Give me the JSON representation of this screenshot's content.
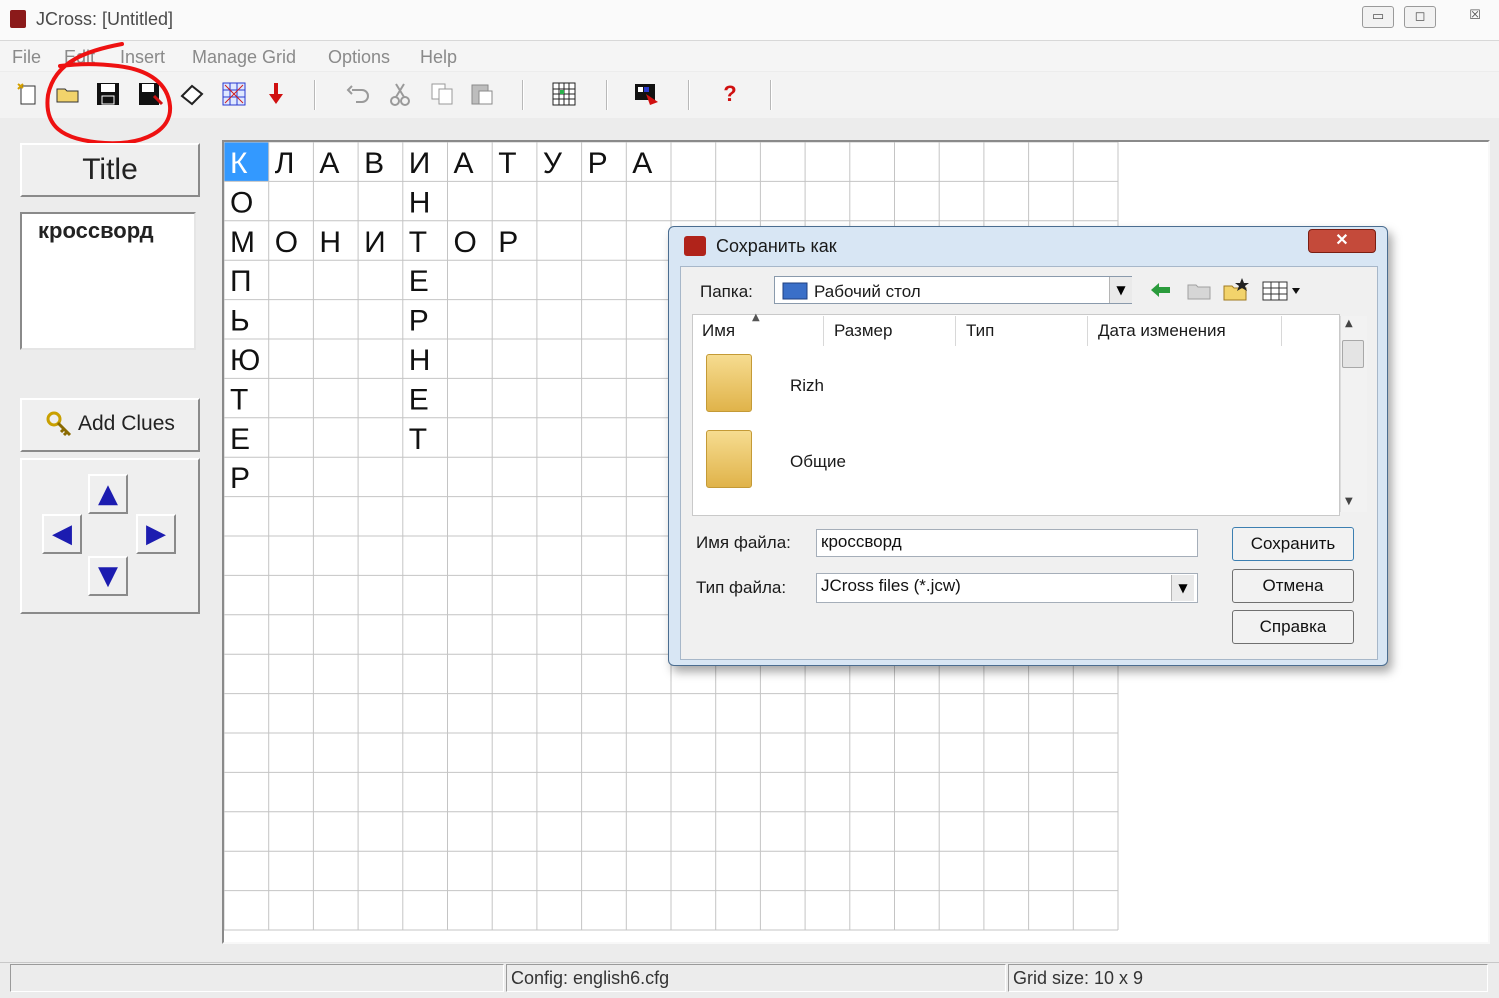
{
  "window": {
    "title": "JCross: [Untitled]"
  },
  "window_controls": {
    "minimize": "▭",
    "maximize": "◻",
    "close": "☒"
  },
  "menu": [
    "File",
    "Edit",
    "Insert",
    "Manage Grid",
    "Options",
    "Help"
  ],
  "toolbar": {
    "icons": [
      "new-file-icon",
      "open-folder-icon",
      "save-icon",
      "save-as-icon",
      "eraser-icon",
      "grid-pattern-icon",
      "down-arrow-icon",
      "undo-icon",
      "cut-icon",
      "copy-icon",
      "paste-icon",
      "grid-icon",
      "palette-icon",
      "help-icon"
    ],
    "help_glyph": "?"
  },
  "left_panel": {
    "title_button": "Title",
    "title_text": "кроссворд",
    "add_clues": "Add Clues",
    "arrows": {
      "up": "▲",
      "left": "◀",
      "right": "▶",
      "down": "▼"
    }
  },
  "grid": {
    "columns": 20,
    "rows": 20,
    "highlight": {
      "row": 0,
      "col": 0,
      "color": "#3399ff"
    },
    "letters": [
      [
        "К",
        "Л",
        "А",
        "В",
        "И",
        "А",
        "Т",
        "У",
        "Р",
        "А"
      ],
      [
        "О",
        "",
        "",
        "",
        "Н"
      ],
      [
        "М",
        "О",
        "Н",
        "И",
        "Т",
        "О",
        "Р"
      ],
      [
        "П",
        "",
        "",
        "",
        "Е"
      ],
      [
        "Ь",
        "",
        "",
        "",
        "Р"
      ],
      [
        "Ю",
        "",
        "",
        "",
        "Н"
      ],
      [
        "Т",
        "",
        "",
        "",
        "Е"
      ],
      [
        "Е",
        "",
        "",
        "",
        "Т"
      ],
      [
        "Р"
      ]
    ]
  },
  "status": {
    "config": "Config: english6.cfg",
    "grid_size": "Grid size: 10 x 9"
  },
  "dialog": {
    "title": "Сохранить как",
    "close_glyph": "✕",
    "folder_label": "Папка:",
    "folder_value": "Рабочий стол",
    "columns": [
      "Имя",
      "Размер",
      "Тип",
      "Дата изменения"
    ],
    "items": [
      "Rizh",
      "Общие"
    ],
    "filename_label": "Имя файла:",
    "filename_value": "кроссворд",
    "filetype_label": "Тип файла:",
    "filetype_value": "JCross files (*.jcw)",
    "buttons": {
      "save": "Сохранить",
      "cancel": "Отмена",
      "help": "Справка"
    },
    "nav_icons": [
      "back-arrow-icon",
      "up-folder-icon",
      "new-folder-icon",
      "view-menu-icon"
    ]
  },
  "colors": {
    "annotation_circle": "#ee1111",
    "arrow_blue": "#1c1cb0",
    "arrow_red": "#d01010"
  }
}
